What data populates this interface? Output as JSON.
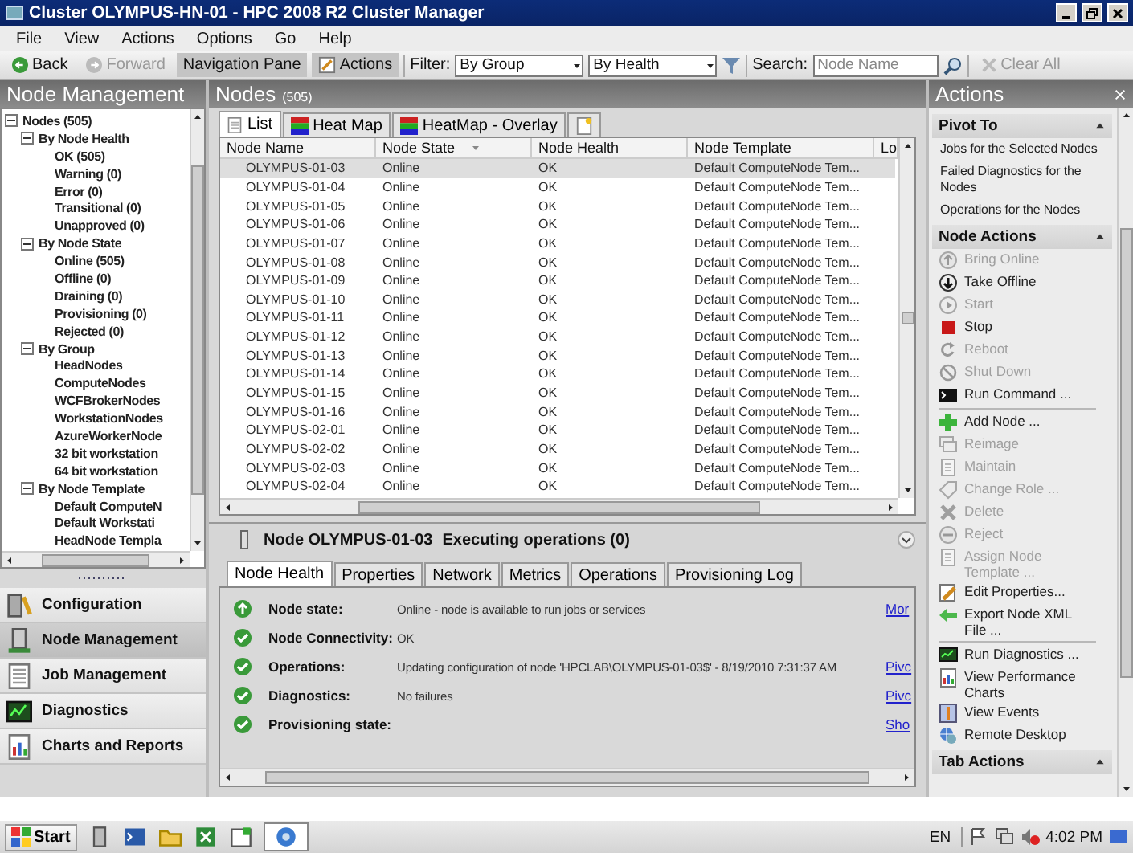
{
  "window": {
    "title": "Cluster OLYMPUS-HN-01 - HPC 2008 R2 Cluster Manager"
  },
  "menu": [
    "File",
    "View",
    "Actions",
    "Options",
    "Go",
    "Help"
  ],
  "toolbar": {
    "back": {
      "label": "Back",
      "disabled": false
    },
    "forward": {
      "label": "Forward",
      "disabled": true
    },
    "navigation_pane": {
      "label": "Navigation Pane",
      "pressed": true
    },
    "actions": {
      "label": "Actions",
      "pressed": true
    },
    "filter_label": "Filter:",
    "filter_group": "By Group",
    "filter_health": "By Health",
    "search_label": "Search:",
    "search_placeholder": "Node Name",
    "clear_all": {
      "label": "Clear All",
      "disabled": true
    }
  },
  "left_pane": {
    "title": "Node Management",
    "tree": [
      {
        "label": "Nodes (505)",
        "expanded": true,
        "children": [
          {
            "label": "By Node Health",
            "expanded": true,
            "children": [
              {
                "label": "OK (505)"
              },
              {
                "label": "Warning (0)"
              },
              {
                "label": "Error (0)"
              },
              {
                "label": "Transitional (0)"
              },
              {
                "label": "Unapproved (0)"
              }
            ]
          },
          {
            "label": "By Node State",
            "expanded": true,
            "children": [
              {
                "label": "Online (505)"
              },
              {
                "label": "Offline (0)"
              },
              {
                "label": "Draining (0)"
              },
              {
                "label": "Provisioning (0)"
              },
              {
                "label": "Rejected (0)"
              }
            ]
          },
          {
            "label": "By Group",
            "expanded": true,
            "children": [
              {
                "label": "HeadNodes"
              },
              {
                "label": "ComputeNodes"
              },
              {
                "label": "WCFBrokerNodes"
              },
              {
                "label": "WorkstationNodes"
              },
              {
                "label": "AzureWorkerNode"
              },
              {
                "label": "32 bit workstation"
              },
              {
                "label": "64 bit workstation"
              }
            ]
          },
          {
            "label": "By Node Template",
            "expanded": true,
            "children": [
              {
                "label": "Default ComputeN"
              },
              {
                "label": "Default Workstati"
              },
              {
                "label": "HeadNode Templa"
              }
            ]
          }
        ]
      }
    ],
    "nav": [
      {
        "label": "Configuration",
        "selected": false
      },
      {
        "label": "Node Management",
        "selected": true
      },
      {
        "label": "Job Management",
        "selected": false
      },
      {
        "label": "Diagnostics",
        "selected": false
      },
      {
        "label": "Charts and Reports",
        "selected": false
      }
    ]
  },
  "nodes": {
    "title": "Nodes",
    "count": "(505)",
    "tabs": [
      {
        "label": "List",
        "selected": true
      },
      {
        "label": "Heat Map",
        "selected": false
      },
      {
        "label": "HeatMap - Overlay",
        "selected": false
      },
      {
        "selected": false
      }
    ],
    "columns": [
      "Node Name",
      "Node State",
      "Node Health",
      "Node Template",
      "Lo"
    ],
    "rows": [
      {
        "cells": [
          "OLYMPUS-01-03",
          "Online",
          "OK",
          "Default ComputeNode Tem..."
        ],
        "selected": true
      },
      {
        "cells": [
          "OLYMPUS-01-04",
          "Online",
          "OK",
          "Default ComputeNode Tem..."
        ],
        "selected": false
      },
      {
        "cells": [
          "OLYMPUS-01-05",
          "Online",
          "OK",
          "Default ComputeNode Tem..."
        ],
        "selected": false
      },
      {
        "cells": [
          "OLYMPUS-01-06",
          "Online",
          "OK",
          "Default ComputeNode Tem..."
        ],
        "selected": false
      },
      {
        "cells": [
          "OLYMPUS-01-07",
          "Online",
          "OK",
          "Default ComputeNode Tem..."
        ],
        "selected": false
      },
      {
        "cells": [
          "OLYMPUS-01-08",
          "Online",
          "OK",
          "Default ComputeNode Tem..."
        ],
        "selected": false
      },
      {
        "cells": [
          "OLYMPUS-01-09",
          "Online",
          "OK",
          "Default ComputeNode Tem..."
        ],
        "selected": false
      },
      {
        "cells": [
          "OLYMPUS-01-10",
          "Online",
          "OK",
          "Default ComputeNode Tem..."
        ],
        "selected": false
      },
      {
        "cells": [
          "OLYMPUS-01-11",
          "Online",
          "OK",
          "Default ComputeNode Tem..."
        ],
        "selected": false
      },
      {
        "cells": [
          "OLYMPUS-01-12",
          "Online",
          "OK",
          "Default ComputeNode Tem..."
        ],
        "selected": false
      },
      {
        "cells": [
          "OLYMPUS-01-13",
          "Online",
          "OK",
          "Default ComputeNode Tem..."
        ],
        "selected": false
      },
      {
        "cells": [
          "OLYMPUS-01-14",
          "Online",
          "OK",
          "Default ComputeNode Tem..."
        ],
        "selected": false
      },
      {
        "cells": [
          "OLYMPUS-01-15",
          "Online",
          "OK",
          "Default ComputeNode Tem..."
        ],
        "selected": false
      },
      {
        "cells": [
          "OLYMPUS-01-16",
          "Online",
          "OK",
          "Default ComputeNode Tem..."
        ],
        "selected": false
      },
      {
        "cells": [
          "OLYMPUS-02-01",
          "Online",
          "OK",
          "Default ComputeNode Tem..."
        ],
        "selected": false
      },
      {
        "cells": [
          "OLYMPUS-02-02",
          "Online",
          "OK",
          "Default ComputeNode Tem..."
        ],
        "selected": false
      },
      {
        "cells": [
          "OLYMPUS-02-03",
          "Online",
          "OK",
          "Default ComputeNode Tem..."
        ],
        "selected": false
      },
      {
        "cells": [
          "OLYMPUS-02-04",
          "Online",
          "OK",
          "Default ComputeNode Tem..."
        ],
        "selected": false
      }
    ]
  },
  "detail": {
    "title": "Node OLYMPUS-01-03",
    "status": "Executing operations (0)",
    "tabs": [
      {
        "label": "Node Health",
        "selected": true
      },
      {
        "label": "Properties",
        "selected": false
      },
      {
        "label": "Network",
        "selected": false
      },
      {
        "label": "Metrics",
        "selected": false
      },
      {
        "label": "Operations",
        "selected": false
      },
      {
        "label": "Provisioning Log",
        "selected": false
      }
    ],
    "rows": [
      {
        "kind": "online",
        "label": "Node state:",
        "value": "Online - node is available to run jobs or services",
        "link": "Mor"
      },
      {
        "kind": "ok",
        "label": "Node Connectivity:",
        "value": "OK"
      },
      {
        "kind": "ok",
        "label": "Operations:",
        "value": "Updating configuration of node 'HPCLAB\\OLYMPUS-01-03$' - 8/19/2010 7:31:37 AM",
        "link": "Pivc"
      },
      {
        "kind": "ok",
        "label": "Diagnostics:",
        "value": "No failures",
        "link": "Pivc"
      },
      {
        "kind": "ok",
        "label": "Provisioning state:",
        "link": "Sho"
      }
    ]
  },
  "actions": {
    "title": "Actions",
    "sections": [
      {
        "title": "Pivot To",
        "expanded": true,
        "groups": [
          [
            {
              "label": "Jobs for the Selected Nodes"
            },
            {
              "label": "Failed Diagnostics for the Nodes"
            },
            {
              "label": "Operations for the Nodes"
            }
          ]
        ]
      },
      {
        "title": "Node Actions",
        "expanded": true,
        "groups": [
          [
            {
              "label": "Bring Online",
              "disabled": true
            },
            {
              "label": "Take Offline",
              "disabled": false
            },
            {
              "label": "Start",
              "disabled": true
            },
            {
              "label": "Stop",
              "disabled": false
            },
            {
              "label": "Reboot",
              "disabled": true
            },
            {
              "label": "Shut Down",
              "disabled": true
            },
            {
              "label": "Run Command ...",
              "disabled": false
            }
          ],
          [
            {
              "label": "Add Node ...",
              "disabled": false
            },
            {
              "label": "Reimage",
              "disabled": true
            },
            {
              "label": "Maintain",
              "disabled": true
            },
            {
              "label": "Change Role ...",
              "disabled": true
            },
            {
              "label": "Delete",
              "disabled": true
            },
            {
              "label": "Reject",
              "disabled": true
            },
            {
              "label": "Assign Node Template ...",
              "disabled": true
            },
            {
              "label": "Edit Properties...",
              "disabled": false
            },
            {
              "label": "Export Node XML File ...",
              "disabled": false
            }
          ],
          [
            {
              "label": "Run Diagnostics ...",
              "disabled": false
            },
            {
              "label": "View Performance Charts",
              "disabled": false
            },
            {
              "label": "View Events",
              "disabled": false
            },
            {
              "label": "Remote Desktop",
              "disabled": false
            }
          ]
        ]
      },
      {
        "title": "Tab Actions",
        "expanded": true
      }
    ]
  },
  "taskbar": {
    "start": "Start",
    "language": "EN",
    "clock": "4:02 PM"
  }
}
